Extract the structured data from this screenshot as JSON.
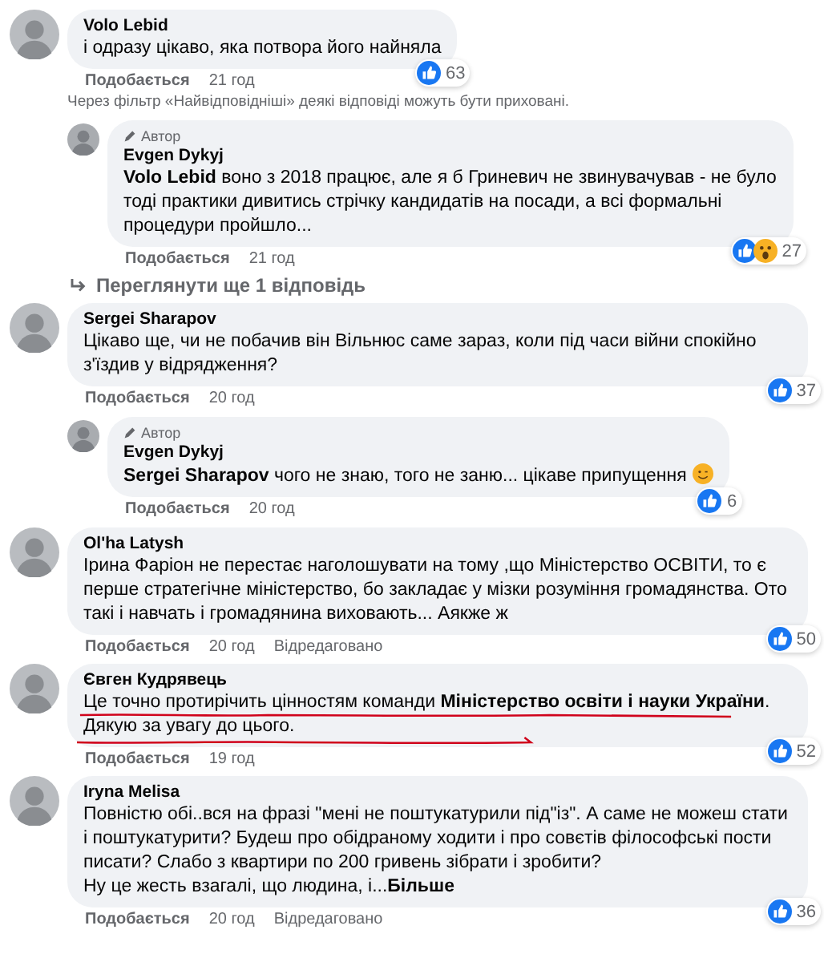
{
  "comments": [
    {
      "author": "Volo Lebid",
      "text": "і одразу цікаво, яка потвора його найняла",
      "reactions": [
        {
          "kind": "like"
        }
      ],
      "count": "63",
      "like_label": "Подобається",
      "time": "21 год",
      "notice": "Через фільтр «Найвідповідніші» деякі відповіді можуть бути приховані.",
      "replies": [
        {
          "author_badge": "Автор",
          "author": "Evgen Dykyj",
          "text": "**Volo Lebid** воно з 2018 працює, але я б Гриневич не звинувачував - не було тоді практики дивитись стрічку кандидатів на посади, а всі формальні процедури пройшло...",
          "emoji": false,
          "reactions": [
            {
              "kind": "like"
            },
            {
              "kind": "wow"
            }
          ],
          "count": "27",
          "like_label": "Подобається",
          "time": "21 год"
        }
      ],
      "more_replies": "Переглянути ще 1 відповідь"
    },
    {
      "author": "Sergei Sharapov",
      "text": "Цікаво ще, чи не побачив він Вільнюс саме зараз, коли під часи війни спокійно з'їздив у відрядження?",
      "reactions": [
        {
          "kind": "like"
        }
      ],
      "count": "37",
      "like_label": "Подобається",
      "time": "20 год",
      "replies": [
        {
          "author_badge": "Автор",
          "author": "Evgen Dykyj",
          "text": "**Sergei Sharapov** чого не знаю, того не заню... цікаве припущення",
          "emoji": true,
          "reactions": [
            {
              "kind": "like"
            }
          ],
          "count": "6",
          "like_label": "Подобається",
          "time": "20 год"
        }
      ]
    },
    {
      "author": "Ol'ha Latysh",
      "text": "Ірина Фаріон не перестає наголошувати на тому ,що Міністерство ОСВІТИ, то є перше стратегічне міністерство, бо закладає у мізки розуміння громадянства. Ото такі і навчать і громадянина виховають... Аякже ж",
      "reactions": [
        {
          "kind": "like"
        }
      ],
      "count": "50",
      "like_label": "Подобається",
      "time": "20 год",
      "edited": "Відредаговано"
    },
    {
      "author": "Євген Кудрявець",
      "text": "Це точно протирічить цінностям команди **Міністерство освіти і науки України**. Дякую за увагу до цього.",
      "scribble": true,
      "reactions": [
        {
          "kind": "like"
        }
      ],
      "count": "52",
      "like_label": "Подобається",
      "time": "19 год"
    },
    {
      "author": "Iryna Melisa",
      "text": "Повністю обі..вся на фразі \"мені не поштукатурили під\"із\". А саме не можеш стати і поштукатурити? Будеш про обідраному ходити і про совєтів філософські пости писати? Слабо з квартири по 200 гривень зібрати і зробити?\nНу це жесть взагалі, що людина, і...",
      "more": "Більше",
      "reactions": [
        {
          "kind": "like"
        }
      ],
      "count": "36",
      "like_label": "Подобається",
      "time": "20 год",
      "edited": "Відредаговано"
    }
  ]
}
